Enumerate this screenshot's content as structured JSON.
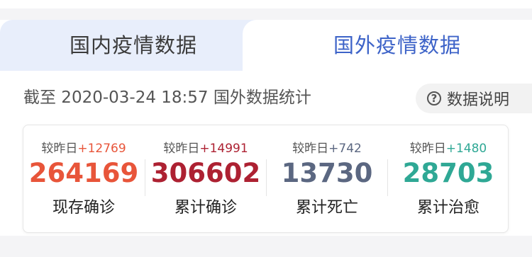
{
  "tabs": [
    {
      "label": "国内疫情数据"
    },
    {
      "label": "国外疫情数据"
    }
  ],
  "meta": {
    "cutoff_text": "截至 2020-03-24 18:57 国外数据统计",
    "explain_label": "数据说明",
    "help_icon_glyph": "?"
  },
  "stats": [
    {
      "compare_label": "较昨日",
      "delta": "+12769",
      "value": "264169",
      "label": "现存确诊",
      "color": "#e8553a"
    },
    {
      "compare_label": "较昨日",
      "delta": "+14991",
      "value": "306602",
      "label": "累计确诊",
      "color": "#ad2132"
    },
    {
      "compare_label": "较昨日",
      "delta": "+742",
      "value": "13730",
      "label": "累计死亡",
      "color": "#5b6781"
    },
    {
      "compare_label": "较昨日",
      "delta": "+1480",
      "value": "28703",
      "label": "累计治愈",
      "color": "#2fa895"
    }
  ],
  "colors": {
    "active_tab": "#3d63c8",
    "inactive_tab_bg": "#e8eefb"
  }
}
